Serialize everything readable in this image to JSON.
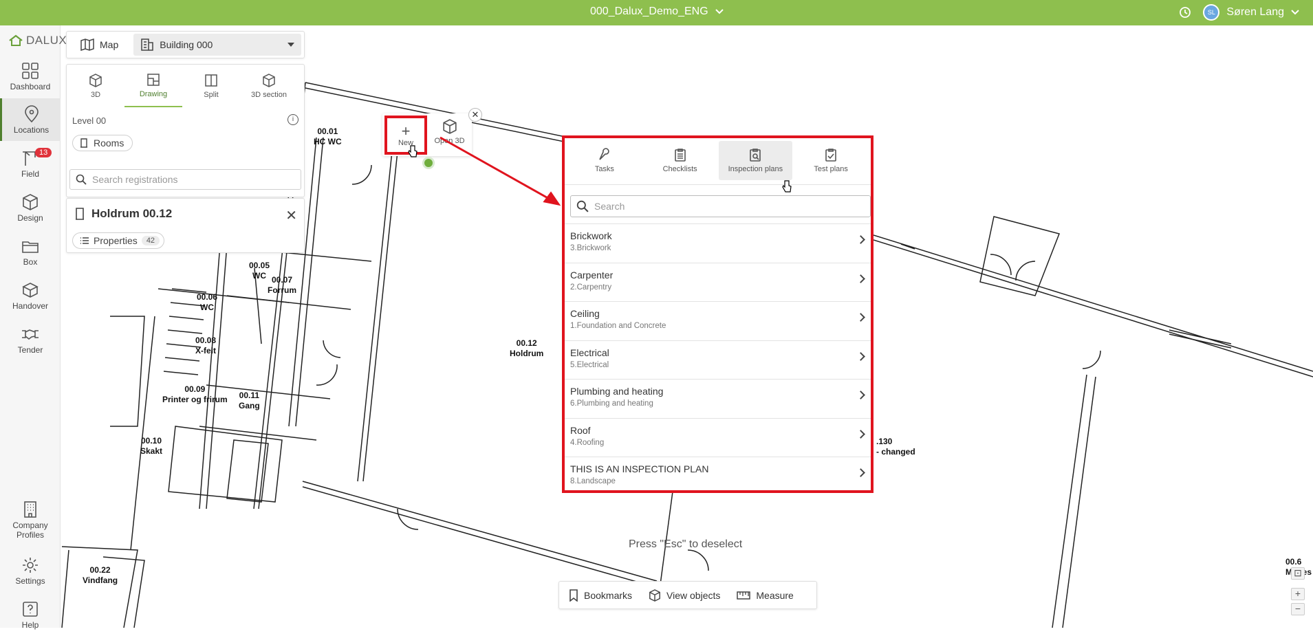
{
  "topbar": {
    "project": "000_Dalux_Demo_ENG",
    "user_initials": "SL",
    "user_name": "Søren Lang"
  },
  "logo": "DALUX",
  "nav": {
    "dashboard": "Dashboard",
    "locations": "Locations",
    "field": "Field",
    "field_badge": "13",
    "design": "Design",
    "box": "Box",
    "handover": "Handover",
    "tender": "Tender",
    "company_profiles": "Company Profiles",
    "settings": "Settings",
    "help": "Help"
  },
  "viewbar": {
    "map": "Map",
    "building": "Building 000"
  },
  "views": {
    "v3d": "3D",
    "drawing": "Drawing",
    "split": "Split",
    "section": "3D section"
  },
  "level": "Level 00",
  "rooms_chip": "Rooms",
  "search_registrations": "Search registrations",
  "room": {
    "title": "Holdrum 00.12",
    "properties": "Properties",
    "properties_count": "42"
  },
  "popup": {
    "new": "New",
    "open3d": "Open 3D"
  },
  "inspect": {
    "tabs": {
      "tasks": "Tasks",
      "checklists": "Checklists",
      "inspection": "Inspection plans",
      "test": "Test plans"
    },
    "search_placeholder": "Search",
    "items": [
      {
        "title": "Brickwork",
        "sub": "3.Brickwork"
      },
      {
        "title": "Carpenter",
        "sub": "2.Carpentry"
      },
      {
        "title": "Ceiling",
        "sub": "1.Foundation and Concrete"
      },
      {
        "title": "Electrical",
        "sub": "5.Electrical"
      },
      {
        "title": "Plumbing and heating",
        "sub": "6.Plumbing and heating"
      },
      {
        "title": "Roof",
        "sub": "4.Roofing"
      },
      {
        "title": "THIS IS AN INSPECTION PLAN",
        "sub": "8.Landscape"
      }
    ]
  },
  "rooms": {
    "r0001a": "00.01",
    "r0001b": "HC WC",
    "r0005a": "00.05",
    "r0005b": "WC",
    "r0006a": "00.06",
    "r0006b": "WC",
    "r0007a": "00.07",
    "r0007b": "Forrum",
    "r0008a": "00.08",
    "r0008b": "X-felt",
    "r0009a": "00.09",
    "r0009b": "Printer og frirum",
    "r0010a": "00.10",
    "r0010b": "Skakt",
    "r0011a": "00.11",
    "r0011b": "Gang",
    "r0012a": "00.12",
    "r0012b": "Holdrum",
    "r0022a": "00.22",
    "r0022b": "Vindfang",
    "r130a": ".130",
    "r130b": "- changed",
    "edge_a": "00.6",
    "edge_b": "Mødes"
  },
  "esc_hint": "Press \"Esc\" to deselect",
  "bottombar": {
    "bookmarks": "Bookmarks",
    "view_objects": "View objects",
    "measure": "Measure"
  },
  "colors": {
    "topbar": "#8ebf4e",
    "highlight": "#e0141e",
    "accent": "#4f7f2e"
  }
}
